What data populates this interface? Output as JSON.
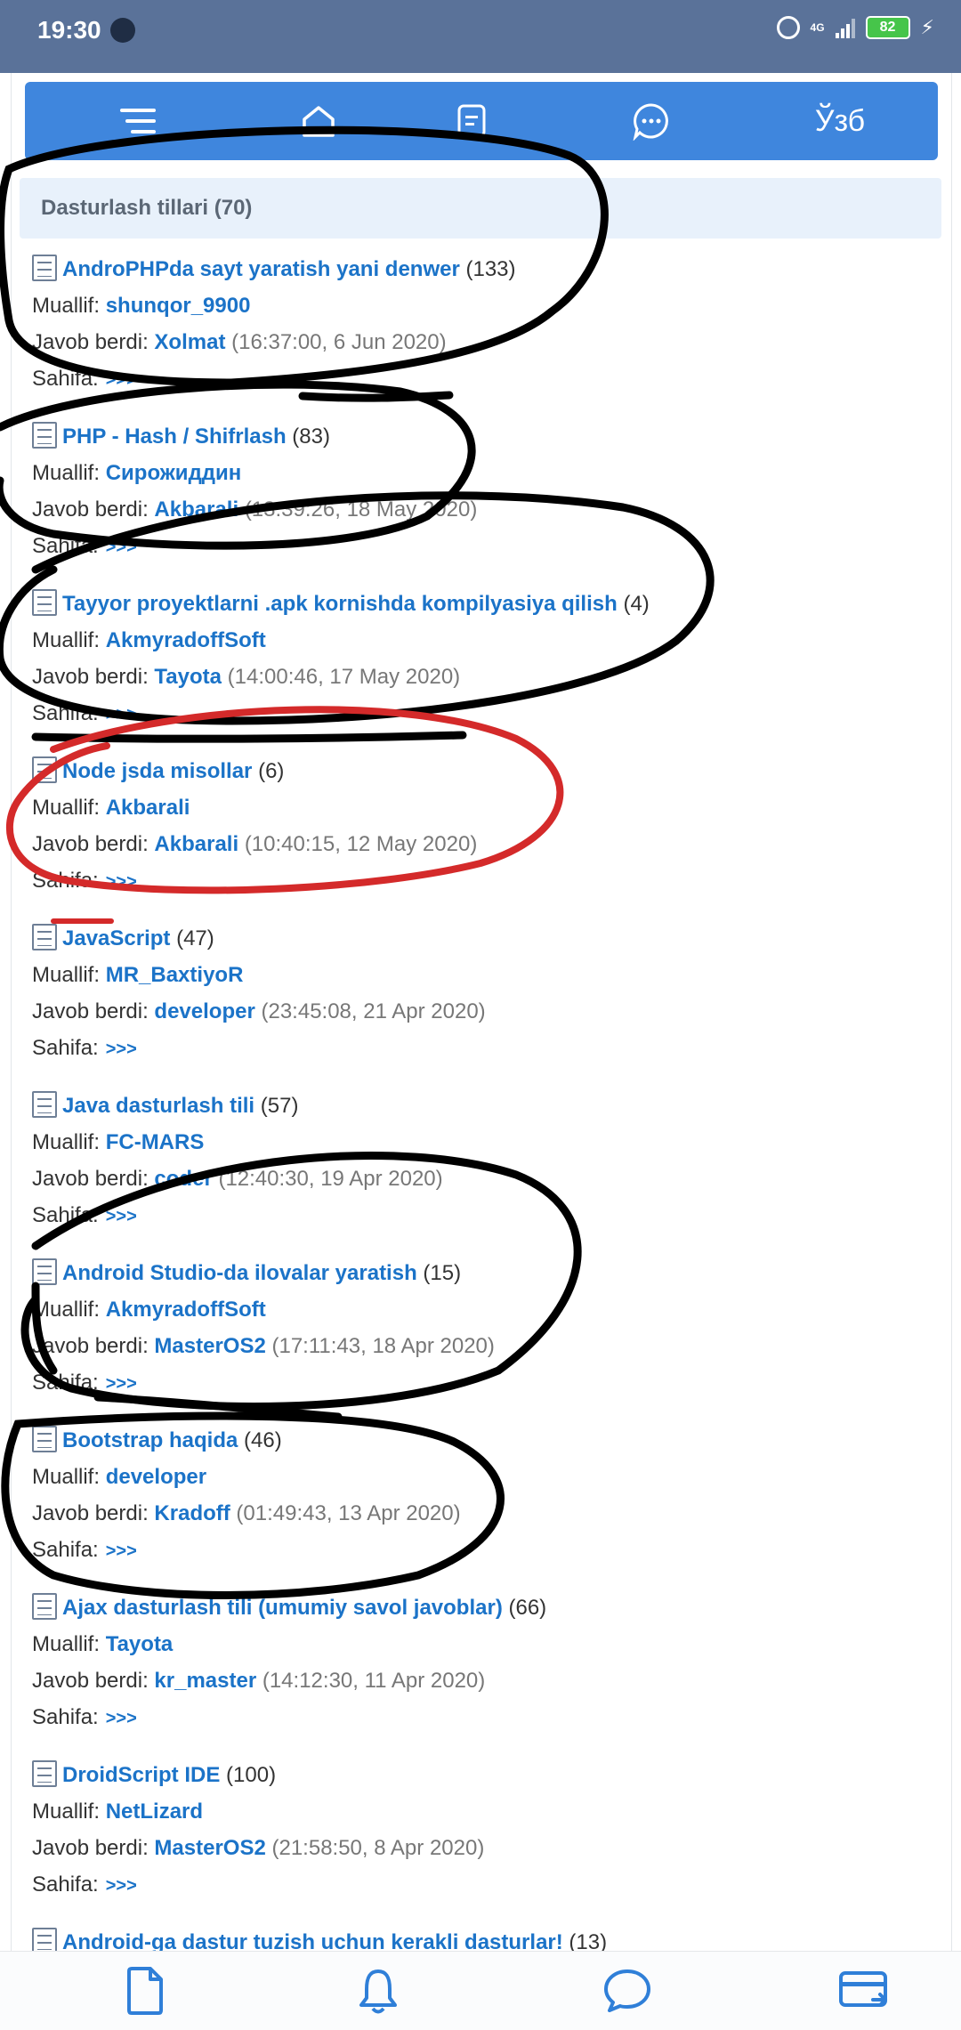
{
  "status_bar": {
    "time": "19:30",
    "network": "4G",
    "battery": "82"
  },
  "nav": {
    "lang": "Ўзб"
  },
  "section": {
    "title": "Dasturlash tillari (70)"
  },
  "labels": {
    "author": "Muallif:",
    "replied": "Javob berdi:",
    "page": "Sahifa:",
    "arrows": ">>>"
  },
  "topics": [
    {
      "title": "AndroPHPda sayt yaratish yani denwer",
      "count": "(133)",
      "author": "shunqor_9900",
      "last_by": "Xolmat",
      "time": "(16:37:00, 6 Jun 2020)"
    },
    {
      "title": "PHP - Hash / Shifrlash",
      "count": "(83)",
      "author": "Сирожиддин",
      "last_by": "Akbarali",
      "time": "(13:39:26, 18 May 2020)"
    },
    {
      "title": "Tayyor proyektlarni .apk kornishda kompilyasiya qilish",
      "count": "(4)",
      "author": "AkmyradoffSoft",
      "last_by": "Tayota",
      "time": "(14:00:46, 17 May 2020)"
    },
    {
      "title": "Node jsda misollar",
      "count": "(6)",
      "author": "Akbarali",
      "last_by": "Akbarali",
      "time": "(10:40:15, 12 May 2020)"
    },
    {
      "title": "JavaScript",
      "count": "(47)",
      "author": "MR_BaxtiyoR",
      "last_by": "developer",
      "time": "(23:45:08, 21 Apr 2020)"
    },
    {
      "title": "Java dasturlash tili",
      "count": "(57)",
      "author": "FC-MARS",
      "last_by": "coder",
      "time": "(12:40:30, 19 Apr 2020)"
    },
    {
      "title": "Android Studio-da ilovalar yaratish",
      "count": "(15)",
      "author": "AkmyradoffSoft",
      "last_by": "MasterOS2",
      "time": "(17:11:43, 18 Apr 2020)"
    },
    {
      "title": "Bootstrap haqida",
      "count": "(46)",
      "author": "developer",
      "last_by": "Kradoff",
      "time": "(01:49:43, 13 Apr 2020)"
    },
    {
      "title": "Ajax dasturlash tili (umumiy savol javoblar)",
      "count": "(66)",
      "author": "Tayota",
      "last_by": "kr_master",
      "time": "(14:12:30, 11 Apr 2020)"
    },
    {
      "title": "DroidScript IDE",
      "count": "(100)",
      "author": "NetLizard",
      "last_by": "MasterOS2",
      "time": "(21:58:50, 8 Apr 2020)"
    },
    {
      "title": "Android-ga dastur tuzish uchun kerakli dasturlar!",
      "count": "(13)"
    }
  ]
}
